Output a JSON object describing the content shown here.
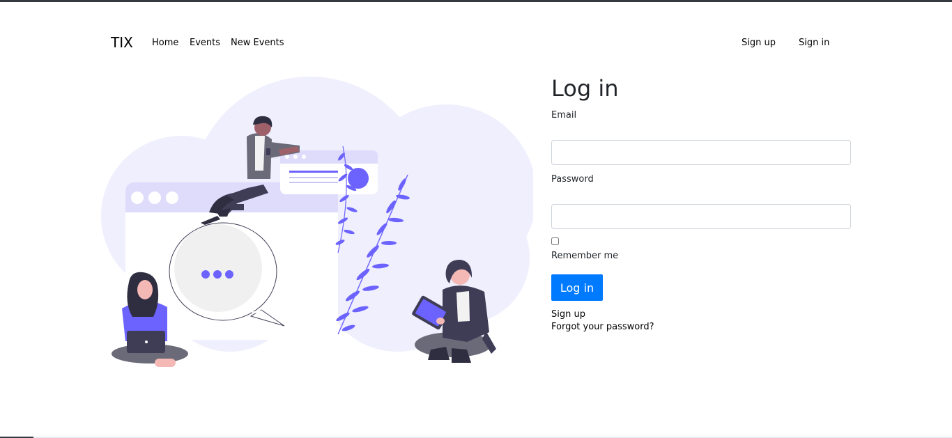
{
  "navbar": {
    "brand": "TIX",
    "links": [
      "Home",
      "Events",
      "New Events"
    ],
    "auth": {
      "sign_up": "Sign up",
      "sign_in": "Sign in"
    }
  },
  "illustration": {
    "name": "people-chatting-illustration",
    "accent_color": "#6c63ff"
  },
  "form": {
    "title": "Log in",
    "email_label": "Email",
    "email_value": "",
    "password_label": "Password",
    "password_value": "",
    "remember_label": "Remember me",
    "remember_checked": false,
    "submit_label": "Log in",
    "sign_up_link": "Sign up",
    "forgot_link": "Forgot your password?"
  },
  "colors": {
    "primary": "#007bff",
    "accent": "#6c63ff",
    "blob": "#f0effd"
  }
}
